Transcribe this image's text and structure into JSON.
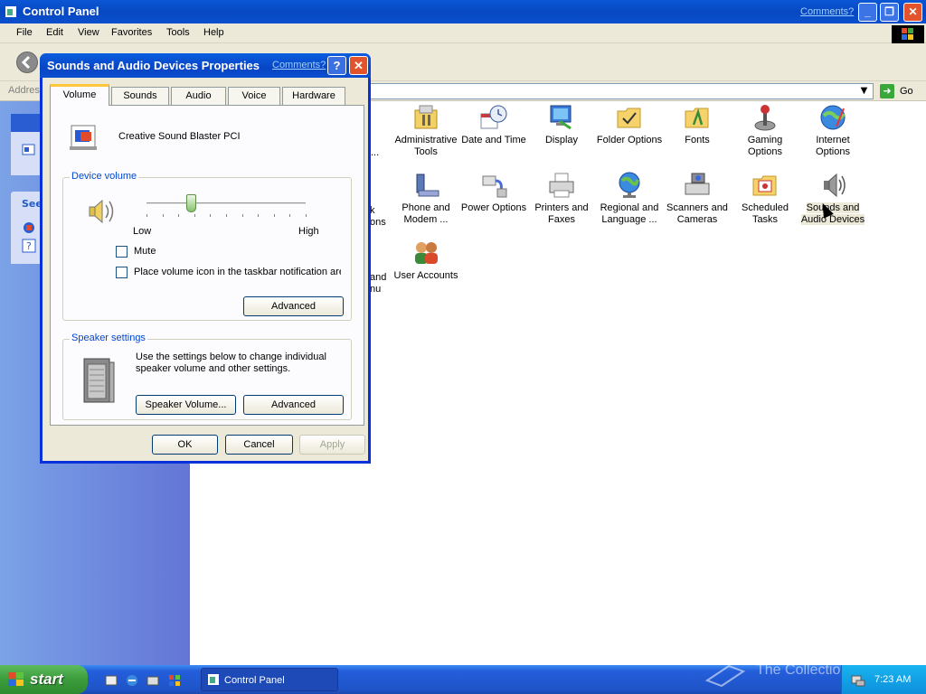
{
  "window": {
    "title": "Control Panel",
    "comments_link": "Comments?",
    "menu": [
      "File",
      "Edit",
      "View",
      "Favorites",
      "Tools",
      "Help"
    ],
    "address_label": "Address",
    "go_label": "Go"
  },
  "left_pane": {
    "see_also_label": "See"
  },
  "items": [
    {
      "label": "Administrative Tools"
    },
    {
      "label": "Date and Time"
    },
    {
      "label": "Display"
    },
    {
      "label": "Folder Options"
    },
    {
      "label": "Fonts"
    },
    {
      "label": "Gaming Options"
    },
    {
      "label": "Internet Options"
    },
    {
      "label": "Phone and Modem ..."
    },
    {
      "label": "Power Options"
    },
    {
      "label": "Printers and Faxes"
    },
    {
      "label": "Regional and Language ..."
    },
    {
      "label": "Scanners and Cameras"
    },
    {
      "label": "Scheduled Tasks"
    },
    {
      "label": "Sounds and Audio Devices"
    },
    {
      "label": "User Accounts"
    }
  ],
  "partial_items": {
    "row2_partial": "k ons",
    "row3_partial": "and nu",
    "row1_partial": "..."
  },
  "dialog": {
    "title": "Sounds and Audio Devices Properties",
    "comments_link": "Comments?",
    "tabs": [
      "Volume",
      "Sounds",
      "Audio",
      "Voice",
      "Hardware"
    ],
    "active_tab": "Volume",
    "device_name": "Creative Sound Blaster PCI",
    "device_volume": {
      "group_label": "Device volume",
      "low_label": "Low",
      "high_label": "High",
      "level": 0.28
    },
    "mute_label": "Mute",
    "mute_checked": false,
    "taskbar_icon_label": "Place volume icon in the taskbar notification are",
    "taskbar_icon_checked": false,
    "advanced_label": "Advanced",
    "speaker_settings": {
      "group_label": "Speaker settings",
      "description": "Use the settings below to change individual speaker volume and other settings.",
      "speaker_volume_label": "Speaker Volume...",
      "advanced_label": "Advanced"
    },
    "ok_label": "OK",
    "cancel_label": "Cancel",
    "apply_label": "Apply"
  },
  "taskbar": {
    "start_label": "start",
    "task_label": "Control Panel",
    "clock": "7:23 AM",
    "watermark": "The Collection Book"
  },
  "colors": {
    "title_blue": "#0a57d6",
    "start_green": "#3c9c3c",
    "taskbar_blue": "#245edb",
    "tray_blue": "#0e8fdc",
    "dialog_face": "#ece9d8",
    "group_label_blue": "#0046d5",
    "slider_green": "#82c36b"
  }
}
